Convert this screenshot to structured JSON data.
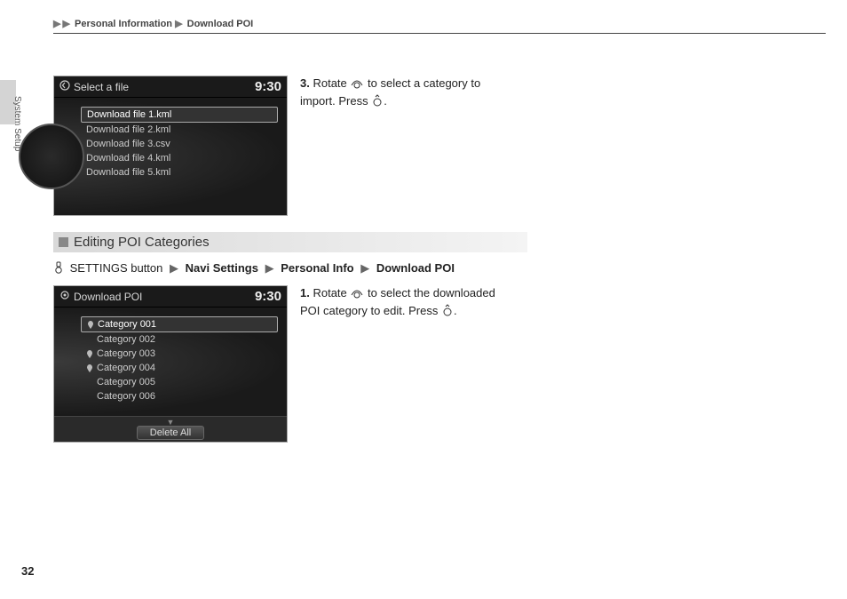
{
  "header": {
    "crumb1": "Personal Information",
    "crumb2": "Download POI"
  },
  "side_label": "System Setup",
  "page_number": "32",
  "screen1": {
    "title": "Select a file",
    "clock": "9:30",
    "files": [
      "Download file 1.kml",
      "Download file 2.kml",
      "Download file 3.csv",
      "Download file 4.kml",
      "Download file 5.kml"
    ]
  },
  "step3": {
    "num": "3.",
    "text_a": "Rotate ",
    "text_b": " to select a category to import. Press ",
    "text_c": "."
  },
  "section_title": "Editing POI Categories",
  "nav_path": {
    "prefix": " SETTINGS button ",
    "n1": "Navi Settings",
    "n2": "Personal Info",
    "n3": "Download POI"
  },
  "screen2": {
    "title": "Download POI",
    "clock": "9:30",
    "categories": [
      "Category 001",
      "Category 002",
      "Category 003",
      "Category 004",
      "Category 005",
      "Category 006"
    ],
    "footer_btn": "Delete All"
  },
  "step1": {
    "num": "1.",
    "text_a": "Rotate ",
    "text_b": " to select the downloaded POI category to edit. Press ",
    "text_c": "."
  }
}
